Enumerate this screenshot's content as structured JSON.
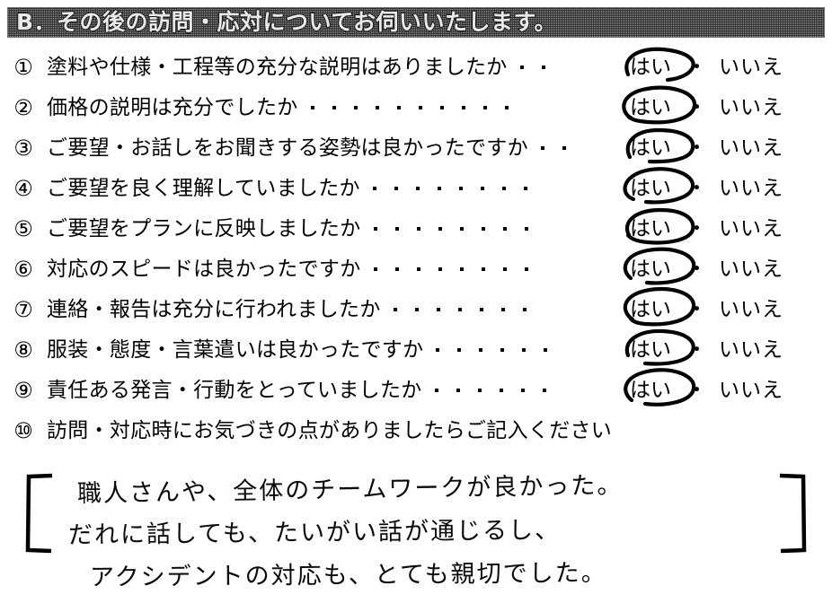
{
  "section": {
    "id": "B",
    "title": "B．その後の訪問・応対についてお伺いいたします。"
  },
  "answer_options": {
    "yes": "はい",
    "no": "いいえ",
    "separator": "・"
  },
  "questions": [
    {
      "number": "①",
      "text": "塗料や仕様・工程等の充分な説明はありましたか",
      "dots": 2,
      "selected": "はい"
    },
    {
      "number": "②",
      "text": "価格の説明は充分でしたか",
      "dots": 10,
      "selected": "はい"
    },
    {
      "number": "③",
      "text": "ご要望・お話しをお聞きする姿勢は良かったですか",
      "dots": 2,
      "selected": "はい"
    },
    {
      "number": "④",
      "text": "ご要望を良く理解していましたか",
      "dots": 8,
      "selected": "はい"
    },
    {
      "number": "⑤",
      "text": "ご要望をプランに反映しましたか",
      "dots": 8,
      "selected": "はい"
    },
    {
      "number": "⑥",
      "text": "対応のスピードは良かったですか",
      "dots": 8,
      "selected": "はい"
    },
    {
      "number": "⑦",
      "text": "連絡・報告は充分に行われましたか",
      "dots": 7,
      "selected": "はい"
    },
    {
      "number": "⑧",
      "text": "服装・態度・言葉遣いは良かったですか",
      "dots": 6,
      "selected": "はい"
    },
    {
      "number": "⑨",
      "text": "責任ある発言・行動をとっていましたか",
      "dots": 6,
      "selected": "はい"
    }
  ],
  "free_comment": {
    "number": "⑩",
    "prompt": "訪問・対応時にお気づきの点がありましたらご記入ください",
    "lines": [
      "職人さんや、全体のチームワークが良かった。",
      "だれに話しても、たいがい話が通じるし、",
      "アクシデントの対応も、とても親切でした。"
    ]
  },
  "colors": {
    "header_background": "#8a8a8a",
    "header_text": "#e9e9e9",
    "ink": "#000000",
    "page_background": "#ffffff"
  }
}
